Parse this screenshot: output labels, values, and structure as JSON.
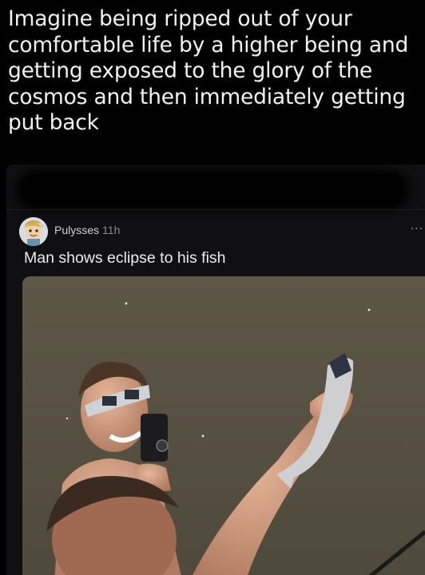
{
  "caption": "Imagine being ripped out of your comfortable life by a higher being and getting exposed to the glory of the cosmos and then immediately getting put back",
  "post": {
    "username": "Pulysses",
    "time": "11h",
    "more_label": "...",
    "title": "Man shows eclipse to his fish"
  },
  "colors": {
    "background": "#000000",
    "card": "#101012",
    "water": "#5b5446"
  },
  "icons": {
    "avatar": "cartoon-face-avatar",
    "more": "ellipsis-icon"
  }
}
